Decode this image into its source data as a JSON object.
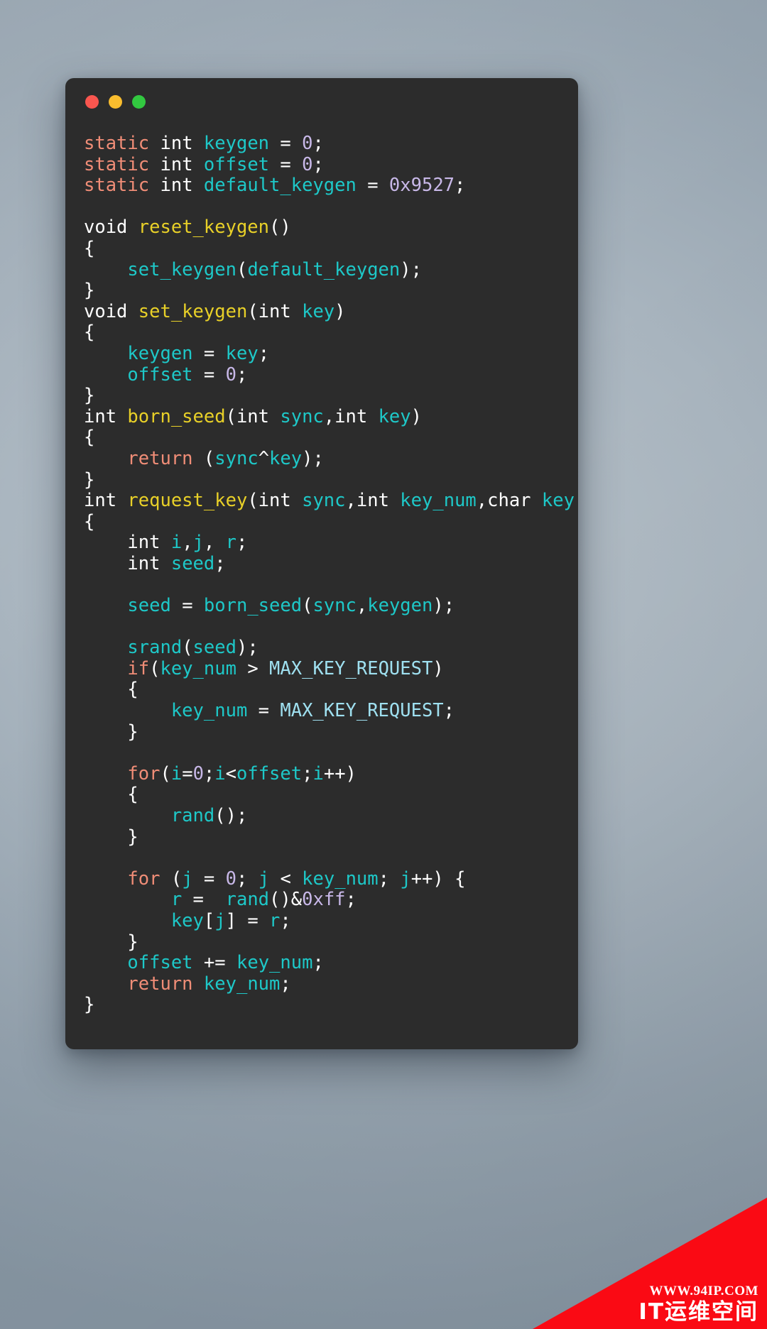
{
  "window": {
    "traffic_lights": [
      {
        "name": "close",
        "color": "#f9564f",
        "label": "Close"
      },
      {
        "name": "minimize",
        "color": "#f9bd2e",
        "label": "Minimize"
      },
      {
        "name": "zoom",
        "color": "#32c840",
        "label": "Zoom"
      }
    ],
    "background": "#2c2c2c"
  },
  "code": {
    "language": "C",
    "font_size": "25.5px",
    "plain_text": "static int keygen = 0;\nstatic int offset = 0;\nstatic int default_keygen = 0x9527;\n\nvoid reset_keygen()\n{\n    set_keygen(default_keygen);\n}\nvoid set_keygen(int key)\n{\n    keygen = key;\n    offset = 0;\n}\nint born_seed(int sync,int key)\n{\n    return (sync^key);\n}\nint request_key(int sync,int key_num,char key[])\n{\n    int i,j, r;\n    int seed;\n\n    seed = born_seed(sync,keygen);\n\n    srand(seed);\n    if(key_num > MAX_KEY_REQUEST)\n    {\n        key_num = MAX_KEY_REQUEST;\n    }\n\n    for(i=0;i<offset;i++)\n    {\n        rand();\n    }\n\n    for (j = 0; j < key_num; j++) {\n        r =  rand()&0xff;\n        key[j] = r;\n    }\n    offset += key_num;\n    return key_num;\n}",
    "identifiers": [
      "keygen",
      "offset",
      "default_keygen",
      "reset_keygen",
      "set_keygen",
      "born_seed",
      "request_key",
      "sync",
      "key",
      "key_num",
      "seed",
      "i",
      "j",
      "r",
      "srand",
      "rand",
      "MAX_KEY_REQUEST"
    ],
    "literals": [
      "0",
      "0x9527",
      "0xff"
    ],
    "keywords": [
      "static",
      "void",
      "int",
      "char",
      "return",
      "if",
      "for"
    ],
    "theme_colors": {
      "keyword": "#f08d77",
      "type": "#ffffff",
      "identifier": "#1ec8c8",
      "function": "#e8d028",
      "number": "#c8b8e8",
      "punctuation": "#ffffff",
      "constant": "#9fe0f0",
      "background": "#2c2c2c"
    }
  },
  "watermark": {
    "url": "WWW.94IP.COM",
    "site_name": "IT运维空间",
    "color": "#fa0a14"
  }
}
